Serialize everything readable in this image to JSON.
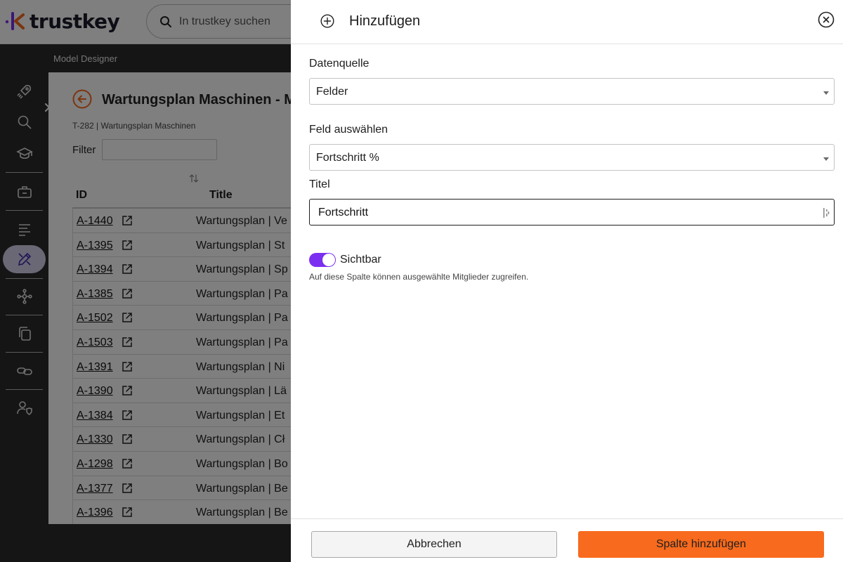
{
  "app": {
    "logo_text": "trustkey",
    "search_placeholder": "In trustkey suchen",
    "subnav_title": "Model Designer",
    "brand_colors": {
      "purple": "#7b2ff0",
      "orange": "#f86a1d"
    }
  },
  "sidenav": {
    "items": [
      {
        "icon": "rocket-icon"
      },
      {
        "icon": "search-icon"
      },
      {
        "icon": "graduation-cap-icon"
      },
      {
        "icon": "briefcase-icon"
      },
      {
        "icon": "list-icon"
      },
      {
        "icon": "design-tools-icon",
        "active": true
      },
      {
        "icon": "network-icon"
      },
      {
        "icon": "copy-icon"
      },
      {
        "icon": "link-icon"
      },
      {
        "icon": "user-shield-icon"
      }
    ]
  },
  "main": {
    "title": "Wartungsplan Maschinen - M",
    "breadcrumb": "T-282 | Wartungsplan Maschinen",
    "filter_label": "Filter",
    "columns": {
      "id": "ID",
      "title": "Title"
    },
    "rows": [
      {
        "id": "A-1440",
        "title": "Wartungsplan | Ve"
      },
      {
        "id": "A-1395",
        "title": "Wartungsplan | St"
      },
      {
        "id": "A-1394",
        "title": "Wartungsplan | Sp"
      },
      {
        "id": "A-1385",
        "title": "Wartungsplan | Pa"
      },
      {
        "id": "A-1502",
        "title": "Wartungsplan | Pa"
      },
      {
        "id": "A-1503",
        "title": "Wartungsplan | Pa"
      },
      {
        "id": "A-1391",
        "title": "Wartungsplan | Ni"
      },
      {
        "id": "A-1390",
        "title": "Wartungsplan | Lä"
      },
      {
        "id": "A-1384",
        "title": "Wartungsplan | Et"
      },
      {
        "id": "A-1330",
        "title": "Wartungsplan | Cł"
      },
      {
        "id": "A-1298",
        "title": "Wartungsplan | Bo"
      },
      {
        "id": "A-1377",
        "title": "Wartungsplan | Be"
      },
      {
        "id": "A-1396",
        "title": "Wartungsplan | Be"
      }
    ]
  },
  "drawer": {
    "title": "Hinzufügen",
    "datasource_label": "Datenquelle",
    "datasource_value": "Felder",
    "field_label": "Feld auswählen",
    "field_value": "Fortschritt %",
    "title_label": "Titel",
    "title_value": "Fortschritt",
    "visible_label": "Sichtbar",
    "visible_on": true,
    "visible_hint": "Auf diese Spalte können ausgewählte Mitglieder zugreifen.",
    "cancel_label": "Abbrechen",
    "submit_label": "Spalte hinzufügen"
  }
}
